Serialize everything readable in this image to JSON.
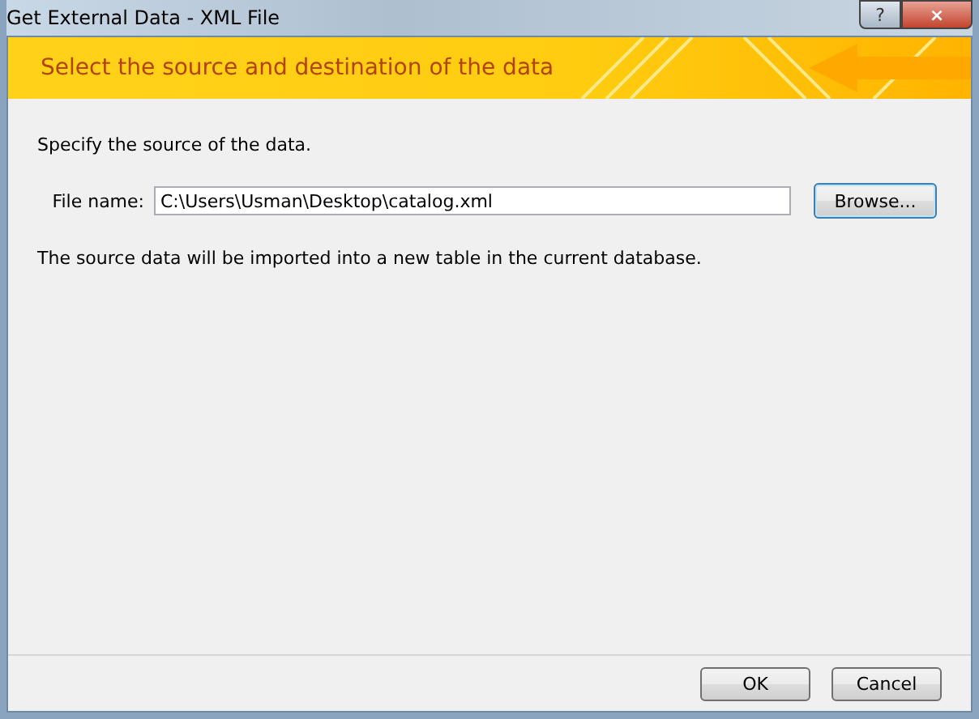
{
  "window": {
    "title": "Get External Data - XML File",
    "title_buttons": [
      "?",
      "×"
    ]
  },
  "banner": {
    "heading": "Select the source and destination of the data"
  },
  "instruction": "Specify the source of the data.",
  "file_field": {
    "label": "File name:",
    "value": "C:\\Users\\Usman\\Desktop\\catalog.xml"
  },
  "browse_button": "Browse...",
  "note": "The source data will be imported into a new table in the current database.",
  "buttons": [
    {
      "label": "OK"
    },
    {
      "label": "Cancel"
    }
  ]
}
